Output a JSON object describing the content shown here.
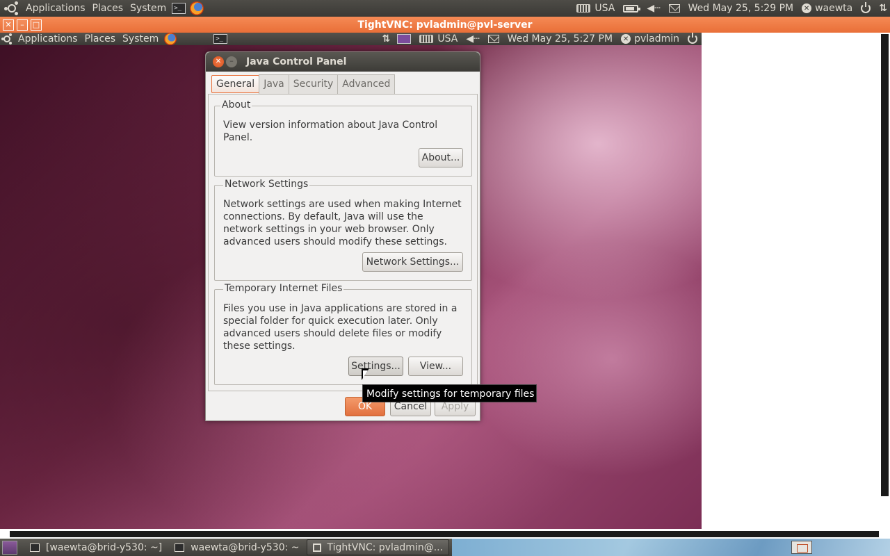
{
  "host_panel": {
    "menus": [
      "Applications",
      "Places",
      "System"
    ],
    "keyboard_layout": "USA",
    "datetime": "Wed May 25,  5:29 PM",
    "username": "waewta"
  },
  "vnc_window": {
    "title": "TightVNC: pvladmin@pvl-server",
    "accent_color": "#e96f38"
  },
  "remote_panel": {
    "menus": [
      "Applications",
      "Places",
      "System"
    ],
    "keyboard_layout": "USA",
    "datetime": "Wed May 25,  5:27 PM",
    "username": "pvladmin"
  },
  "java_control_panel": {
    "title": "Java Control Panel",
    "tabs": [
      {
        "label": "General",
        "active": true
      },
      {
        "label": "Java",
        "active": false
      },
      {
        "label": "Security",
        "active": false
      },
      {
        "label": "Advanced",
        "active": false
      }
    ],
    "about": {
      "legend": "About",
      "text_line1": "View version information about Java Control",
      "text_line2": "Panel.",
      "button": "About..."
    },
    "network": {
      "legend": "Network Settings",
      "text_line1": "Network settings are used when making Internet",
      "text_line2": "connections.  By default, Java will use the",
      "text_line3": "network settings in your web browser.  Only",
      "text_line4": "advanced users should modify these settings.",
      "button": "Network Settings..."
    },
    "temp_files": {
      "legend": "Temporary Internet Files",
      "text_line1": "Files you use in Java applications are stored in a",
      "text_line2": "special folder for quick execution later.  Only",
      "text_line3": "advanced users should delete files or modify",
      "text_line4": "these settings.",
      "settings_button": "Settings...",
      "view_button": "View..."
    },
    "footer": {
      "ok": "OK",
      "cancel": "Cancel",
      "apply": "Apply"
    },
    "tooltip": "Modify settings for temporary files"
  },
  "taskbar": {
    "tasks": [
      {
        "label": "[waewta@brid-y530: ~]",
        "active": false
      },
      {
        "label": "waewta@brid-y530: ~",
        "active": false
      },
      {
        "label": "TightVNC: pvladmin@...",
        "active": true
      }
    ]
  }
}
